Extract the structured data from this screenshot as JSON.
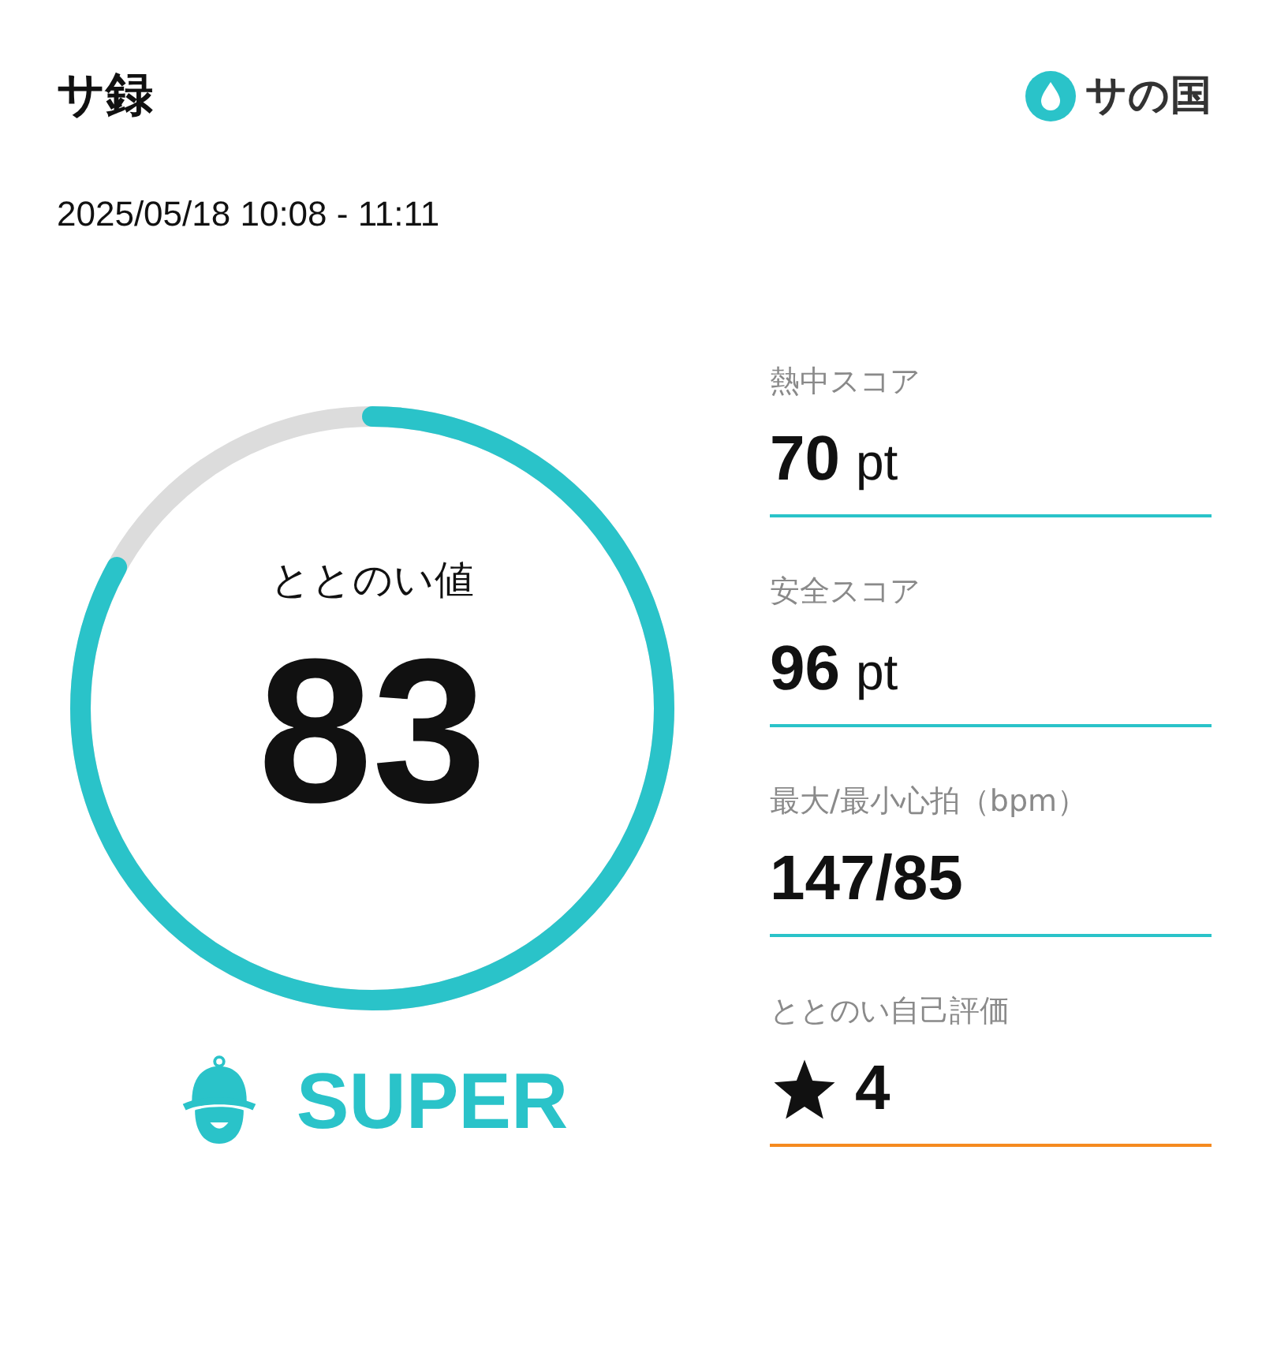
{
  "header": {
    "title": "サ録",
    "logo_text": "サの国"
  },
  "session": {
    "time_range": "2025/05/18 10:08 - 11:11"
  },
  "gauge": {
    "label": "ととのい値",
    "value": "83",
    "rank": "SUPER"
  },
  "stats": [
    {
      "kind": "score",
      "label": "熱中スコア",
      "value": "70",
      "unit": "pt",
      "color": "#2ac3c9"
    },
    {
      "kind": "score",
      "label": "安全スコア",
      "value": "96",
      "unit": "pt",
      "color": "#2ac3c9"
    },
    {
      "kind": "plain",
      "label": "最大/最小心拍（bpm）",
      "value": "147/85",
      "color": "#2ac3c9"
    },
    {
      "kind": "rating",
      "label": "ととのい自己評価",
      "value": "4",
      "color": "#f58a1f"
    }
  ]
}
